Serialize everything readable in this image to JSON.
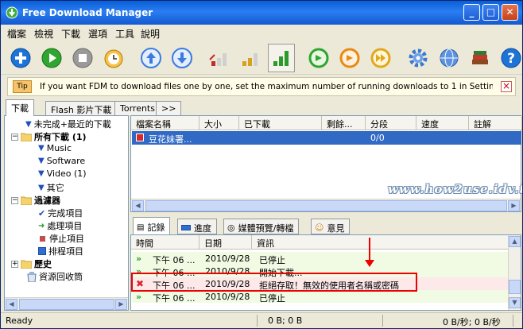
{
  "window": {
    "title": "Free Download Manager"
  },
  "menu": [
    "檔案",
    "檢視",
    "下載",
    "選項",
    "工具",
    "說明"
  ],
  "toolbar": {
    "buttons": [
      {
        "name": "add-download-icon",
        "color": "#1e73d6"
      },
      {
        "name": "start-download-icon",
        "color": "#2fa62f"
      },
      {
        "name": "stop-download-icon",
        "color": "#8a8a8a"
      },
      {
        "name": "scheduler-icon",
        "color": "#d08a1c"
      },
      {
        "name": "move-up-icon",
        "color": "#3b7be0"
      },
      {
        "name": "move-down-icon",
        "color": "#3b7be0"
      },
      {
        "name": "speed-low-icon",
        "color": "#c42a2a"
      },
      {
        "name": "speed-medium-icon",
        "color": "#d6a11e"
      },
      {
        "name": "speed-high-icon",
        "color": "#2a9a2a"
      },
      {
        "name": "download-refresh-icon",
        "color": "#2fa62f"
      },
      {
        "name": "download-switch-icon",
        "color": "#e88a12"
      },
      {
        "name": "download-burst-icon",
        "color": "#e0a81c"
      },
      {
        "name": "settings-gear-icon",
        "color": "#3c78d0"
      },
      {
        "name": "network-globe-icon",
        "color": "#3c78d0"
      },
      {
        "name": "library-books-icon",
        "color": "#8a4a1e"
      },
      {
        "name": "help-icon",
        "color": "#1e73d6"
      }
    ]
  },
  "tip": {
    "badge": "Tip",
    "text": "If you want FDM to download files one by one, set the maximum number of running downloads to 1 in Settings | Downloads"
  },
  "left_tabs": [
    "下載",
    "Flash 影片下載",
    "Torrents",
    ">>"
  ],
  "tree": {
    "items": [
      {
        "label": "未完成+最近的下載",
        "kind": "arrow",
        "bold": false
      },
      {
        "label": "所有下載 (1)",
        "kind": "folder",
        "bold": true
      },
      {
        "label": "Music",
        "kind": "arrow",
        "bold": false
      },
      {
        "label": "Software",
        "kind": "arrow",
        "bold": false
      },
      {
        "label": "Video (1)",
        "kind": "arrow",
        "bold": false
      },
      {
        "label": "其它",
        "kind": "arrow",
        "bold": false
      },
      {
        "label": "過濾器",
        "kind": "folder",
        "bold": true
      },
      {
        "label": "完成項目",
        "kind": "check",
        "bold": false
      },
      {
        "label": "處理項目",
        "kind": "play",
        "bold": false
      },
      {
        "label": "停止項目",
        "kind": "stop",
        "bold": false
      },
      {
        "label": "排程項目",
        "kind": "sched",
        "bold": false
      },
      {
        "label": "歷史",
        "kind": "folder",
        "bold": true
      },
      {
        "label": "資源回收筒",
        "kind": "bin",
        "bold": false
      }
    ]
  },
  "downloads": {
    "columns": [
      "檔案名稱",
      "大小",
      "已下載",
      "剩餘...",
      "分段",
      "速度",
      "註解"
    ],
    "rows": [
      {
        "name": "豆花妹署...",
        "size": "",
        "downloaded": "",
        "remaining": "",
        "sections": "0/0",
        "speed": "",
        "comment": ""
      }
    ]
  },
  "watermark": "www.how2use.idv.tw",
  "bottom_tabs": [
    "記錄",
    "進度",
    "媒體預覽/轉檔",
    "意見"
  ],
  "log": {
    "columns": [
      "時間",
      "日期",
      "資訊"
    ],
    "rows": [
      {
        "status": "ok",
        "time": "下午 06 ...",
        "date": "2010/9/28",
        "info": "已停止"
      },
      {
        "status": "ok",
        "time": "下午 06 ...",
        "date": "2010/9/28",
        "info": "開始下載..."
      },
      {
        "status": "error",
        "time": "下午 06 ...",
        "date": "2010/9/28",
        "info": "拒絕存取！無效的使用者名稱或密碼"
      },
      {
        "status": "ok",
        "time": "下午 06 ...",
        "date": "2010/9/28",
        "info": "已停止"
      }
    ]
  },
  "status": {
    "left": "Ready",
    "traffic": "0 B; 0 B",
    "speed": "0 B/秒; 0 B/秒"
  },
  "colors": {
    "selection": "#316ac5",
    "log_row_bg": "#f1fbe4",
    "error_row_bg": "#fde9e9",
    "highlight": "#ee0000"
  }
}
